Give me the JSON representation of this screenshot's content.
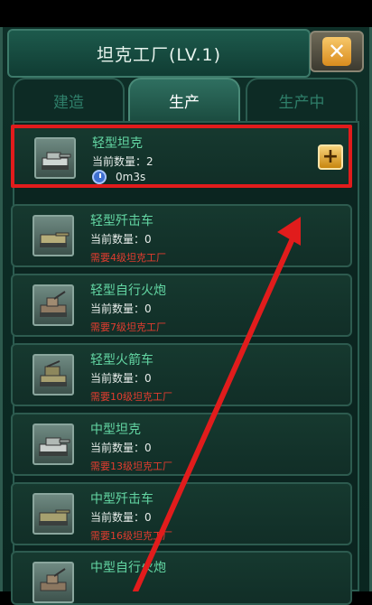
{
  "window": {
    "title": "坦克工厂(LV.1)",
    "close_icon": "close-icon"
  },
  "tabs": [
    {
      "label": "建造",
      "active": false
    },
    {
      "label": "生产",
      "active": true
    },
    {
      "label": "生产中",
      "active": false
    }
  ],
  "units": [
    {
      "name": "轻型坦克",
      "quantity": "当前数量：2",
      "timer": "0m3s",
      "requirement": null,
      "highlight": true,
      "icon": "light-tank-icon"
    },
    {
      "name": "轻型歼击车",
      "quantity": "当前数量：0",
      "requirement": "需要4级坦克工厂",
      "icon": "light-tank-destroyer-icon"
    },
    {
      "name": "轻型自行火炮",
      "quantity": "当前数量：0",
      "requirement": "需要7级坦克工厂",
      "icon": "light-sp-artillery-icon"
    },
    {
      "name": "轻型火箭车",
      "quantity": "当前数量：0",
      "requirement": "需要10级坦克工厂",
      "icon": "light-rocket-vehicle-icon"
    },
    {
      "name": "中型坦克",
      "quantity": "当前数量：0",
      "requirement": "需要13级坦克工厂",
      "icon": "medium-tank-icon"
    },
    {
      "name": "中型歼击车",
      "quantity": "当前数量：0",
      "requirement": "需要16级坦克工厂",
      "icon": "medium-tank-destroyer-icon"
    },
    {
      "name": "中型自行火炮",
      "quantity": "",
      "requirement": null,
      "icon": "medium-sp-artillery-icon"
    }
  ],
  "colors": {
    "highlight_border": "#e11c1c",
    "unit_name": "#63d6a3",
    "requirement_text": "#e23c2f",
    "annotation_arrow": "#e11c1c"
  },
  "annotation": {
    "type": "arrow",
    "points_to": "plus-button"
  }
}
